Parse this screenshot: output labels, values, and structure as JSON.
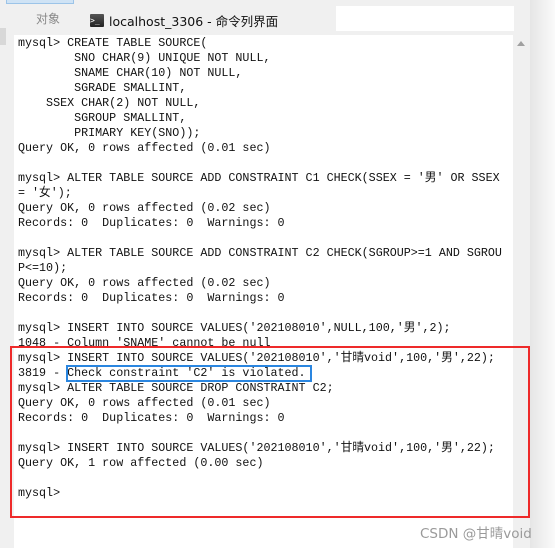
{
  "tabs": {
    "objects": "对象",
    "active": "localhost_3306 - 命令列界面"
  },
  "terminal_lines": [
    "mysql> CREATE TABLE SOURCE(",
    "        SNO CHAR(9) UNIQUE NOT NULL,",
    "        SNAME CHAR(10) NOT NULL,",
    "        SGRADE SMALLINT,",
    "    SSEX CHAR(2) NOT NULL,",
    "        SGROUP SMALLINT,",
    "        PRIMARY KEY(SNO));",
    "Query OK, 0 rows affected (0.01 sec)",
    "",
    "mysql> ALTER TABLE SOURCE ADD CONSTRAINT C1 CHECK(SSEX = '男' OR SSEX",
    "= '女');",
    "Query OK, 0 rows affected (0.02 sec)",
    "Records: 0  Duplicates: 0  Warnings: 0",
    "",
    "mysql> ALTER TABLE SOURCE ADD CONSTRAINT C2 CHECK(SGROUP>=1 AND SGROU",
    "P<=10);",
    "Query OK, 0 rows affected (0.02 sec)",
    "Records: 0  Duplicates: 0  Warnings: 0",
    "",
    "mysql> INSERT INTO SOURCE VALUES('202108010',NULL,100,'男',2);",
    "1048 - Column 'SNAME' cannot be null",
    "mysql> INSERT INTO SOURCE VALUES('202108010','甘晴void',100,'男',22);",
    "3819 - Check constraint 'C2' is violated.",
    "mysql> ALTER TABLE SOURCE DROP CONSTRAINT C2;",
    "Query OK, 0 rows affected (0.01 sec)",
    "Records: 0  Duplicates: 0  Warnings: 0",
    "",
    "mysql> INSERT INTO SOURCE VALUES('202108010','甘晴void',100,'男',22);",
    "Query OK, 1 row affected (0.00 sec)",
    "",
    "mysql> "
  ],
  "watermark": "CSDN @甘晴void",
  "colors": {
    "highlight_red": "#ee2a2a",
    "highlight_blue": "#2a86e0"
  }
}
